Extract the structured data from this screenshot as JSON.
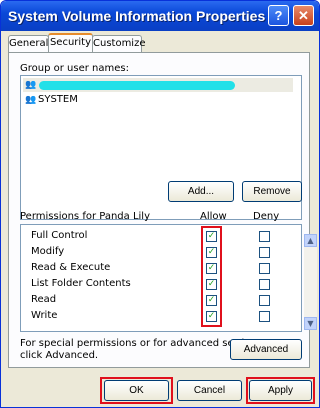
{
  "window": {
    "title": "System Volume Information Properties"
  },
  "titlebar_buttons": {
    "help": "?",
    "close": "✕"
  },
  "tabs": [
    {
      "label": "General"
    },
    {
      "label": "Security"
    },
    {
      "label": "Customize"
    }
  ],
  "groups": {
    "label": "Group or user names:",
    "users": [
      {
        "name": "",
        "icon": "users-icon"
      },
      {
        "name": "SYSTEM",
        "icon": "users-icon"
      }
    ]
  },
  "buttons": {
    "add": "Add...",
    "remove": "Remove",
    "advanced": "Advanced",
    "ok": "OK",
    "cancel": "Cancel",
    "apply": "Apply"
  },
  "permissions": {
    "header": "Permissions for Panda Lily",
    "allow": "Allow",
    "deny": "Deny",
    "items": [
      {
        "name": "Full Control",
        "allow": true,
        "deny": false
      },
      {
        "name": "Modify",
        "allow": true,
        "deny": false
      },
      {
        "name": "Read & Execute",
        "allow": true,
        "deny": false
      },
      {
        "name": "List Folder Contents",
        "allow": true,
        "deny": false
      },
      {
        "name": "Read",
        "allow": true,
        "deny": false
      },
      {
        "name": "Write",
        "allow": true,
        "deny": false
      }
    ]
  },
  "special": {
    "line1": "For special permissions or for advanced settings,",
    "line2": "click Advanced."
  },
  "colors": {
    "highlight": "#e0101c",
    "redacted_bar": "#22e0e8"
  }
}
